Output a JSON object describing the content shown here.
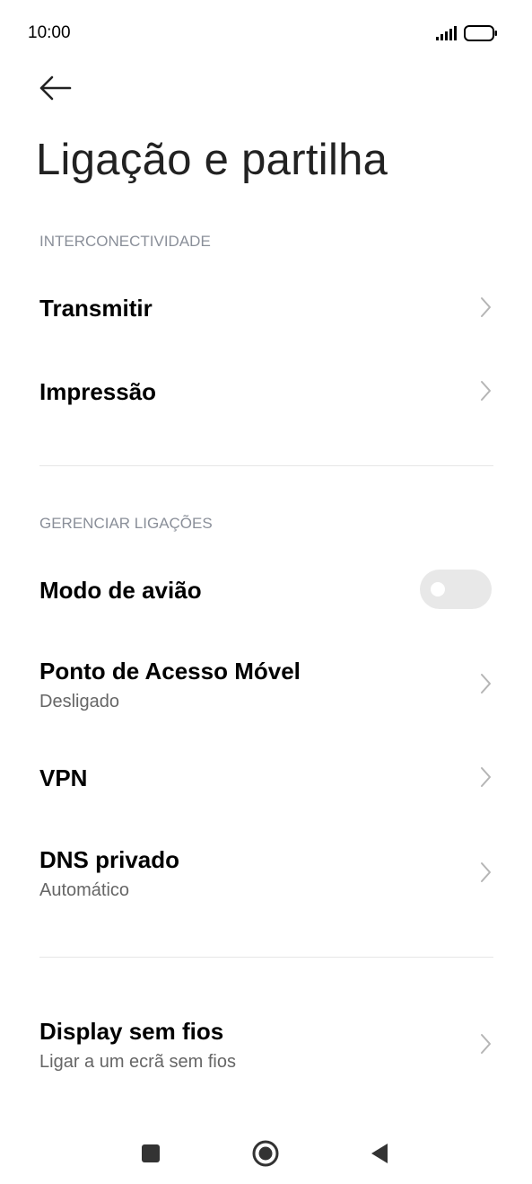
{
  "status_bar": {
    "time": "10:00",
    "icons": [
      "signal-icon",
      "battery-icon"
    ]
  },
  "header": {
    "back_icon": "arrow-left-icon",
    "title": "Ligação e partilha"
  },
  "sections": {
    "interconnectivity": {
      "header": "INTERCONECTIVIDADE",
      "items": [
        {
          "label": "Transmitir"
        },
        {
          "label": "Impressão"
        }
      ]
    },
    "manage_connections": {
      "header": "GERENCIAR LIGAÇÕES",
      "airplane_mode": {
        "label": "Modo de avião",
        "enabled": false
      },
      "items": [
        {
          "label": "Ponto de Acesso Móvel",
          "subtitle": "Desligado"
        },
        {
          "label": "VPN"
        },
        {
          "label": "DNS privado",
          "subtitle": "Automático"
        }
      ]
    },
    "other": {
      "items": [
        {
          "label": "Display sem fios",
          "subtitle": "Ligar a um ecrã sem fios"
        }
      ]
    }
  },
  "nav_bar": {
    "icons": [
      "recents-square-icon",
      "home-circle-icon",
      "back-triangle-icon"
    ]
  },
  "colors": {
    "section_header": "#8a8f99",
    "subtitle": "#666666",
    "chevron": "#b5b5b5",
    "toggle_off": "#e8e8e8",
    "divider": "#e6e6e6"
  }
}
